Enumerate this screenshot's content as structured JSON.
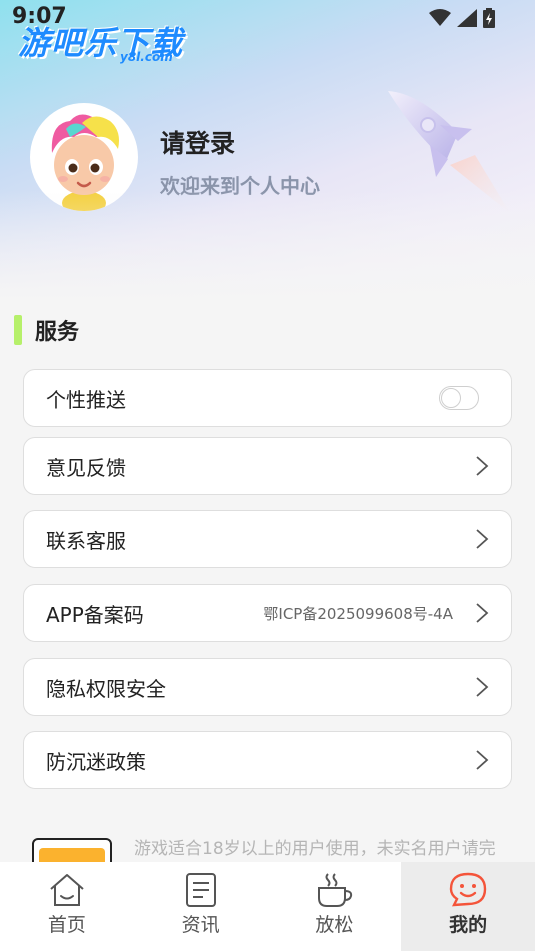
{
  "status_bar": {
    "time": "9:07"
  },
  "brand": {
    "logo_text": "游吧乐下载",
    "logo_sub": "y8l.com"
  },
  "profile": {
    "title": "请登录",
    "subtitle": "欢迎来到个人中心"
  },
  "services": {
    "title": "服务",
    "items": [
      {
        "label": "个性推送",
        "type": "toggle",
        "enabled": false
      },
      {
        "label": "意见反馈",
        "type": "link"
      },
      {
        "label": "联系客服",
        "type": "link"
      },
      {
        "label": "APP备案码",
        "type": "link",
        "value": "鄂ICP备2025099608号-4A"
      },
      {
        "label": "隐私权限安全",
        "type": "link"
      },
      {
        "label": "防沉迷政策",
        "type": "link"
      }
    ]
  },
  "notice": {
    "text": "游戏适合18岁以上的用户使用，未实名用户请完"
  },
  "tabs": [
    {
      "label": "首页",
      "icon": "home-icon",
      "active": false
    },
    {
      "label": "资讯",
      "icon": "news-icon",
      "active": false
    },
    {
      "label": "放松",
      "icon": "coffee-icon",
      "active": false
    },
    {
      "label": "我的",
      "icon": "smiley-chat-icon",
      "active": true
    }
  ],
  "colors": {
    "accent_green": "#b6f06a",
    "active_tab_icon": "#f4543a",
    "logo_blue": "#1e8bff"
  }
}
